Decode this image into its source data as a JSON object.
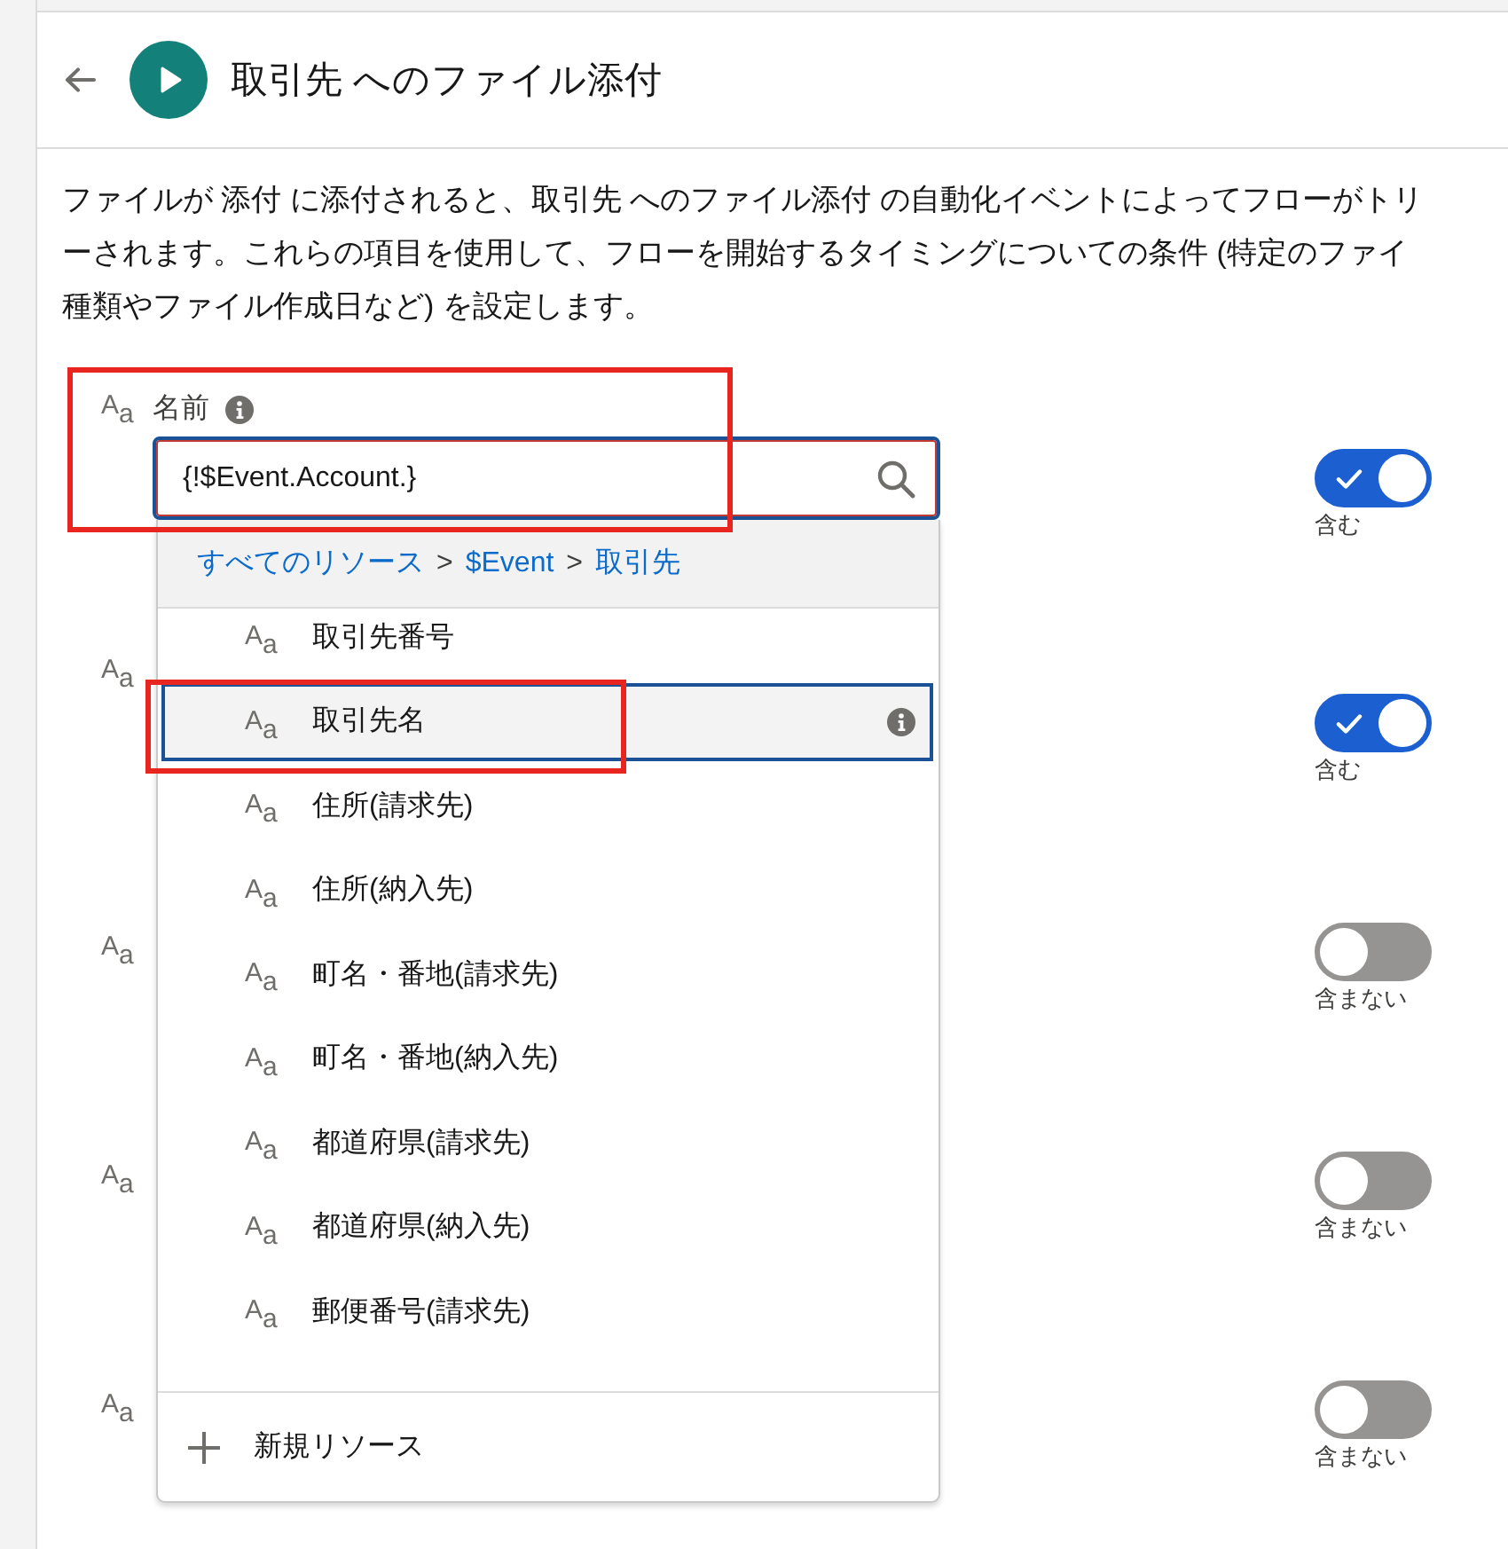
{
  "header": {
    "title": "取引先 へのファイル添付"
  },
  "description_lines": [
    "ファイルが 添付 に添付されると、取引先 へのファイル添付 の自動化イベントによってフローがトリ",
    "ーされます。これらの項目を使用して、フローを開始するタイミングについての条件 (特定のファイ",
    "種類やファイル作成日など) を設定します。"
  ],
  "fields": [
    {
      "type_icon": "A$_{a}$",
      "label": "名前",
      "value": "{!$Event.Account.}",
      "on": true,
      "toggle_label": "含む"
    },
    {
      "type_icon": "A$_{a}$",
      "on": true,
      "toggle_label": "含む"
    },
    {
      "type_icon": "A$_{a}$",
      "on": false,
      "toggle_label": "含まない"
    },
    {
      "type_icon": "A$_{a}$",
      "on": false,
      "toggle_label": "含まない"
    },
    {
      "type_icon": "A$_{a}$",
      "on": false,
      "toggle_label": "含まない"
    }
  ],
  "resource_menu": {
    "breadcrumb": [
      {
        "kind": "link",
        "text": "すべてのリソース"
      },
      {
        "kind": "separator",
        "text": ">"
      },
      {
        "kind": "link",
        "text": "$Event"
      },
      {
        "kind": "separator",
        "text": ">"
      },
      {
        "kind": "link",
        "text": "取引先"
      }
    ],
    "items": [
      {
        "type_icon": "A$_{a}$",
        "label": "取引先番号",
        "selected": false
      },
      {
        "type_icon": "A$_{a}$",
        "label": "取引先名",
        "selected": true
      },
      {
        "type_icon": "A$_{a}$",
        "label": "住所(請求先)",
        "selected": false
      },
      {
        "type_icon": "A$_{a}$",
        "label": "住所(納入先)",
        "selected": false
      },
      {
        "type_icon": "A$_{a}$",
        "label": "町名・番地(請求先)",
        "selected": false
      },
      {
        "type_icon": "A$_{a}$",
        "label": "町名・番地(納入先)",
        "selected": false
      },
      {
        "type_icon": "A$_{a}$",
        "label": "都道府県(請求先)",
        "selected": false
      },
      {
        "type_icon": "A$_{a}$",
        "label": "都道府県(納入先)",
        "selected": false
      },
      {
        "type_icon": "A$_{a}$",
        "label": "郵便番号(請求先)",
        "selected": false
      }
    ],
    "footer_action": "新規リソース"
  }
}
